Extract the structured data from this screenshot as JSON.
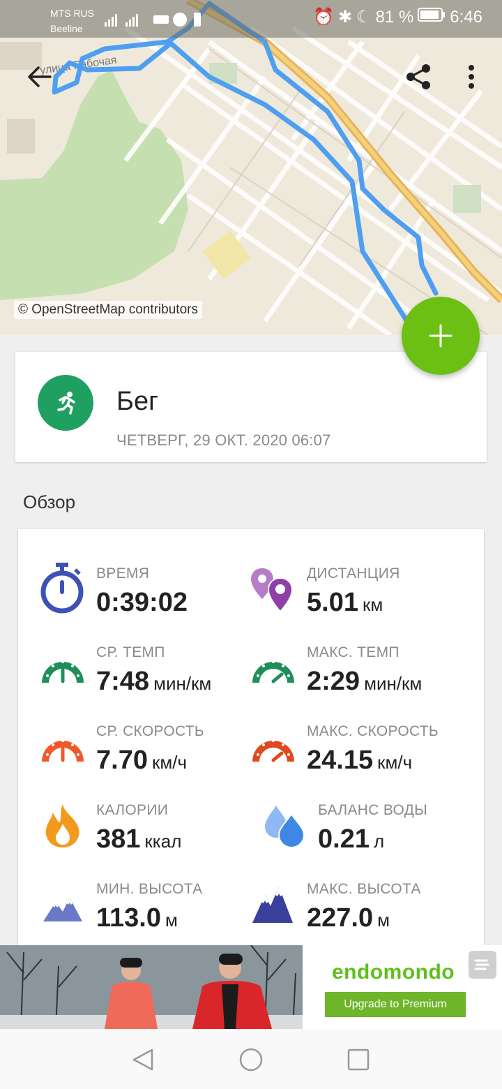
{
  "status_bar": {
    "carrier_1": "MTS RUS",
    "carrier_2": "Beeline",
    "battery": "81 %",
    "time": "6:46"
  },
  "map": {
    "attribution": "© OpenStreetMap contributors",
    "street_label": "улица Рабочая"
  },
  "activity": {
    "sport": "Бег",
    "date": "ЧЕТВЕРГ, 29 ОКТ. 2020 06:07",
    "sport_icon": "running-person-icon",
    "sport_color": "#20a060"
  },
  "overview": {
    "title": "Обзор",
    "stats": [
      {
        "label": "ВРЕМЯ",
        "value": "0:39:02",
        "unit": "",
        "icon": "stopwatch-icon",
        "color": "#3f51b5"
      },
      {
        "label": "ДИСТАНЦИЯ",
        "value": "5.01",
        "unit": "км",
        "icon": "map-pin-icon",
        "color": "#8e3fa8"
      },
      {
        "label": "СР. ТЕМП",
        "value": "7:48",
        "unit": "мин/км",
        "icon": "pace-gauge-icon",
        "color": "#1f8f5a"
      },
      {
        "label": "МАКС. ТЕМП",
        "value": "2:29",
        "unit": "мин/км",
        "icon": "pace-gauge-icon",
        "color": "#1f8f5a"
      },
      {
        "label": "СР. СКОРОСТЬ",
        "value": "7.70",
        "unit": "км/ч",
        "icon": "speed-gauge-icon",
        "color": "#f05a2a"
      },
      {
        "label": "МАКС. СКОРОСТЬ",
        "value": "24.15",
        "unit": "км/ч",
        "icon": "speed-gauge-icon",
        "color": "#e0481f"
      },
      {
        "label": "КАЛОРИИ",
        "value": "381",
        "unit": "ккал",
        "icon": "flame-icon",
        "color": "#f39a1e"
      },
      {
        "label": "БАЛАНС ВОДЫ",
        "value": "0.21",
        "unit": "л",
        "icon": "water-drops-icon",
        "color": "#4a8fe8"
      },
      {
        "label": "МИН. ВЫСОТА",
        "value": "113.0",
        "unit": "м",
        "icon": "mountain-icon",
        "color": "#6a78c8"
      },
      {
        "label": "МАКС. ВЫСОТА",
        "value": "227.0",
        "unit": "м",
        "icon": "mountain-icon",
        "color": "#3b3f9c"
      }
    ]
  },
  "ad": {
    "brand": "endomondo",
    "cta": "Upgrade to Premium"
  },
  "colors": {
    "accent": "#6cbf13",
    "route": "#4f9ff0"
  }
}
